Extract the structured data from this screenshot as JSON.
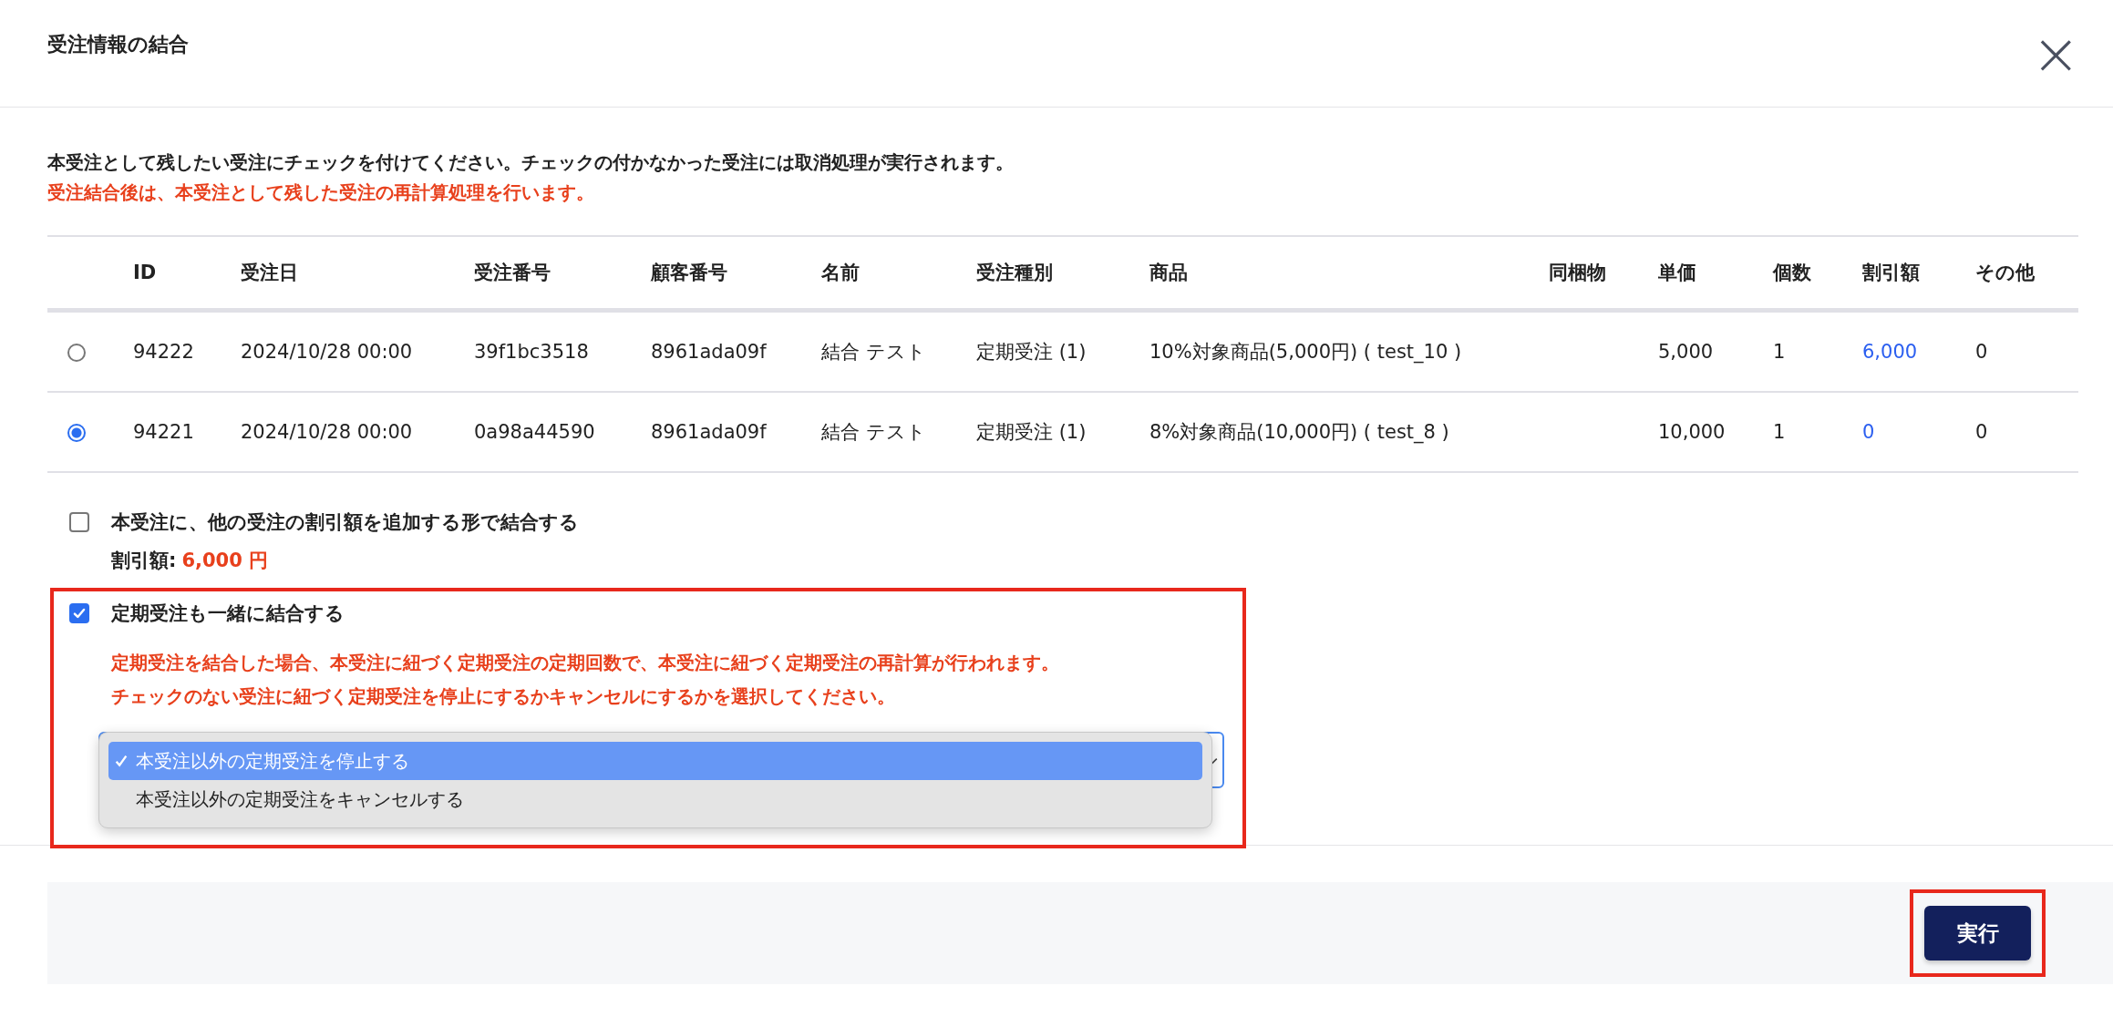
{
  "dialog": {
    "title": "受注情報の結合",
    "close_label": "×"
  },
  "instructions": [
    {
      "text": "本受注として残したい受注にチェックを付けてください。チェックの付かなかった受注には取消処理が実行されます。",
      "kind": "normal"
    },
    {
      "text": "受注結合後は、本受注として残した受注の再計算処理を行います。",
      "kind": "warning"
    }
  ],
  "table": {
    "columns": [
      "ID",
      "受注日",
      "受注番号",
      "顧客番号",
      "名前",
      "受注種別",
      "商品",
      "同梱物",
      "単価",
      "個数",
      "割引額",
      "その他"
    ],
    "rows": [
      {
        "selected": false,
        "cells": [
          "94222",
          "2024/10/28 00:00",
          "39f1bc3518",
          "8961ada09f",
          "結合 テスト",
          "定期受注 (1)",
          "10%対象商品(5,000円) ( test_10 )",
          "",
          "5,000",
          "1",
          "6,000",
          "0"
        ]
      },
      {
        "selected": true,
        "cells": [
          "94221",
          "2024/10/28 00:00",
          "0a98a44590",
          "8961ada09f",
          "結合 テスト",
          "定期受注 (1)",
          "8%対象商品(10,000円) ( test_8 )",
          "",
          "10,000",
          "1",
          "0",
          "0"
        ]
      }
    ]
  },
  "options": [
    {
      "label": "本受注に、他の受注の割引額を追加する形で結合する",
      "checked": false,
      "highlighted": false,
      "detail_label": "割引額:",
      "detail_value": "6,000 円"
    },
    {
      "label": "定期受注も一緒に結合する",
      "checked": true,
      "highlighted": true,
      "notes": [
        "定期受注を結合した場合、本受注に紐づく定期受注の定期回数で、本受注に紐づく定期受注の再計算が行われます。",
        "チェックのない受注に紐づく定期受注を停止にするかキャンセルにするかを選択してください。"
      ],
      "dropdown": {
        "expanded": true,
        "items": [
          {
            "label": "本受注以外の定期受注を停止する",
            "selected": true
          },
          {
            "label": "本受注以外の定期受注をキャンセルする",
            "selected": false
          }
        ]
      }
    }
  ],
  "footer": {
    "button": {
      "label": "実行",
      "highlighted": true
    }
  }
}
